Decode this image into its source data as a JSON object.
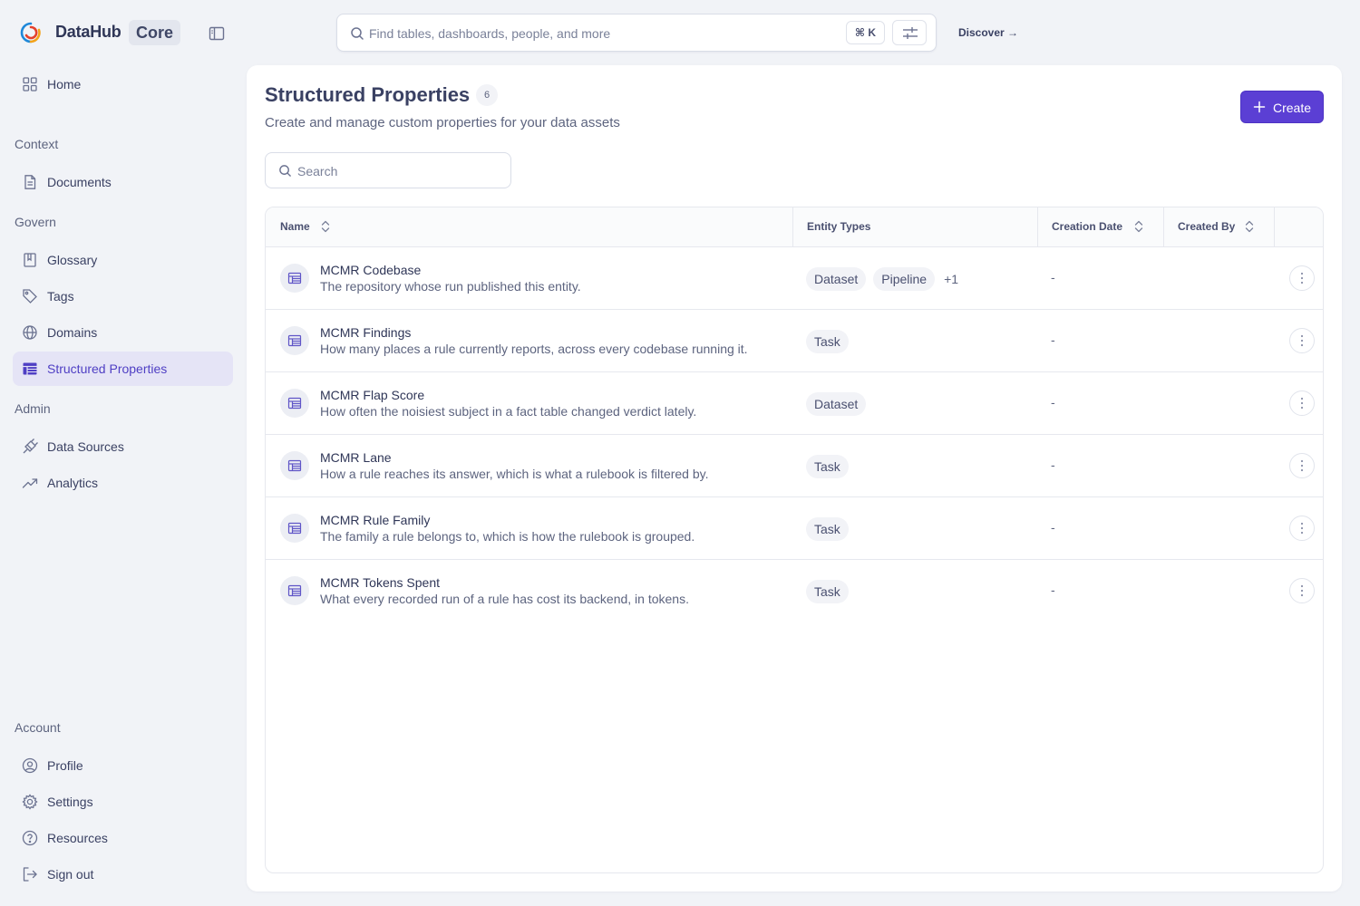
{
  "app": {
    "brand": "DataHub",
    "edition": "Core"
  },
  "topbar": {
    "search_placeholder": "Find tables, dashboards, people, and more",
    "shortcut": "⌘ K",
    "discover_label": "Discover →"
  },
  "sidebar": {
    "home": "Home",
    "sections": {
      "context": "Context",
      "govern": "Govern",
      "admin": "Admin",
      "account": "Account"
    },
    "items": {
      "documents": "Documents",
      "glossary": "Glossary",
      "tags": "Tags",
      "domains": "Domains",
      "structured_properties": "Structured Properties",
      "data_sources": "Data Sources",
      "analytics": "Analytics",
      "profile": "Profile",
      "settings": "Settings",
      "resources": "Resources",
      "sign_out": "Sign out"
    },
    "active_item": "structured_properties"
  },
  "page": {
    "title": "Structured Properties",
    "count": "6",
    "subtitle": "Create and manage custom properties for your data assets",
    "create_label": "Create",
    "search_placeholder": "Search"
  },
  "table": {
    "columns": {
      "name": "Name",
      "entity_types": "Entity Types",
      "creation_date": "Creation Date",
      "created_by": "Created By"
    },
    "rows": [
      {
        "name": "MCMR Codebase",
        "description": "The repository whose run published this entity.",
        "types": [
          "Dataset",
          "Pipeline"
        ],
        "more": "+1",
        "date": "-"
      },
      {
        "name": "MCMR Findings",
        "description": "How many places a rule currently reports, across every codebase running it.",
        "types": [
          "Task"
        ],
        "more": "",
        "date": "-"
      },
      {
        "name": "MCMR Flap Score",
        "description": "How often the noisiest subject in a fact table changed verdict lately.",
        "types": [
          "Dataset"
        ],
        "more": "",
        "date": "-"
      },
      {
        "name": "MCMR Lane",
        "description": "How a rule reaches its answer, which is what a rulebook is filtered by.",
        "types": [
          "Task"
        ],
        "more": "",
        "date": "-"
      },
      {
        "name": "MCMR Rule Family",
        "description": "The family a rule belongs to, which is how the rulebook is grouped.",
        "types": [
          "Task"
        ],
        "more": "",
        "date": "-"
      },
      {
        "name": "MCMR Tokens Spent",
        "description": "What every recorded run of a rule has cost its backend, in tokens.",
        "types": [
          "Task"
        ],
        "more": "",
        "date": "-"
      }
    ]
  },
  "colors": {
    "accent": "#5b3fd4",
    "active_nav_bg": "#e5e4f6",
    "page_bg": "#f1f3f7"
  }
}
